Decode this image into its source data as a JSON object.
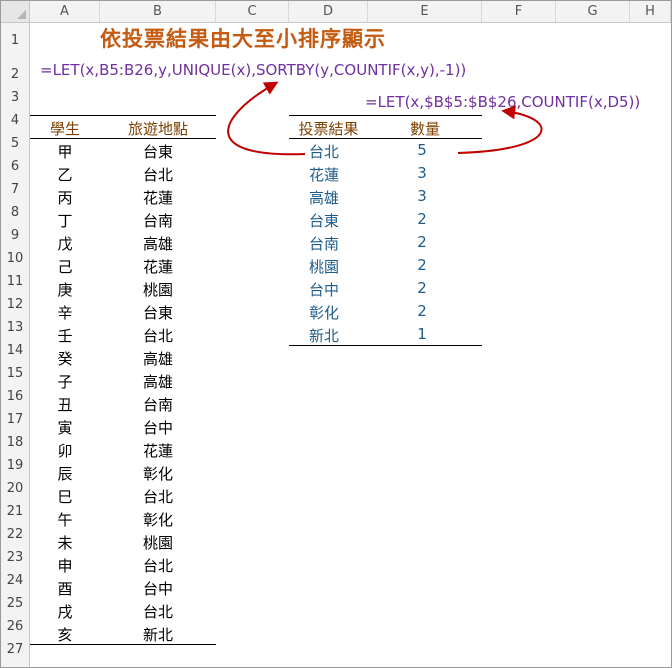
{
  "columns": [
    "A",
    "B",
    "C",
    "D",
    "E",
    "F",
    "G",
    "H"
  ],
  "rows": [
    "1",
    "2",
    "3",
    "4",
    "5",
    "6",
    "7",
    "8",
    "9",
    "10",
    "11",
    "12",
    "13",
    "14",
    "15",
    "16",
    "17",
    "18",
    "19",
    "20",
    "21",
    "22",
    "23",
    "24",
    "25",
    "26",
    "27"
  ],
  "title": "依投票結果由大至小排序顯示",
  "formula_top": "=LET(x,B5:B26,y,UNIQUE(x),SORTBY(y,COUNTIF(x,y),-1))",
  "formula_right": "=LET(x,$B$5:$B$26,COUNTIF(x,D5))",
  "left_table": {
    "headers": [
      "學生",
      "旅遊地點"
    ],
    "rows": [
      [
        "甲",
        "台東"
      ],
      [
        "乙",
        "台北"
      ],
      [
        "丙",
        "花蓮"
      ],
      [
        "丁",
        "台南"
      ],
      [
        "戊",
        "高雄"
      ],
      [
        "己",
        "花蓮"
      ],
      [
        "庚",
        "桃園"
      ],
      [
        "辛",
        "台東"
      ],
      [
        "壬",
        "台北"
      ],
      [
        "癸",
        "高雄"
      ],
      [
        "子",
        "高雄"
      ],
      [
        "丑",
        "台南"
      ],
      [
        "寅",
        "台中"
      ],
      [
        "卯",
        "花蓮"
      ],
      [
        "辰",
        "彰化"
      ],
      [
        "巳",
        "台北"
      ],
      [
        "午",
        "彰化"
      ],
      [
        "未",
        "桃園"
      ],
      [
        "申",
        "台北"
      ],
      [
        "酉",
        "台中"
      ],
      [
        "戌",
        "台北"
      ],
      [
        "亥",
        "新北"
      ]
    ]
  },
  "right_table": {
    "headers": [
      "投票結果",
      "數量"
    ],
    "rows": [
      [
        "台北",
        "5"
      ],
      [
        "花蓮",
        "3"
      ],
      [
        "高雄",
        "3"
      ],
      [
        "台東",
        "2"
      ],
      [
        "台南",
        "2"
      ],
      [
        "桃園",
        "2"
      ],
      [
        "台中",
        "2"
      ],
      [
        "彰化",
        "2"
      ],
      [
        "新北",
        "1"
      ]
    ]
  },
  "colors": {
    "title": "#c55a11",
    "formula": "#7030a0",
    "header_text": "#7f3f00",
    "result_text": "#1f5c8b",
    "arrow": "#c00000"
  }
}
